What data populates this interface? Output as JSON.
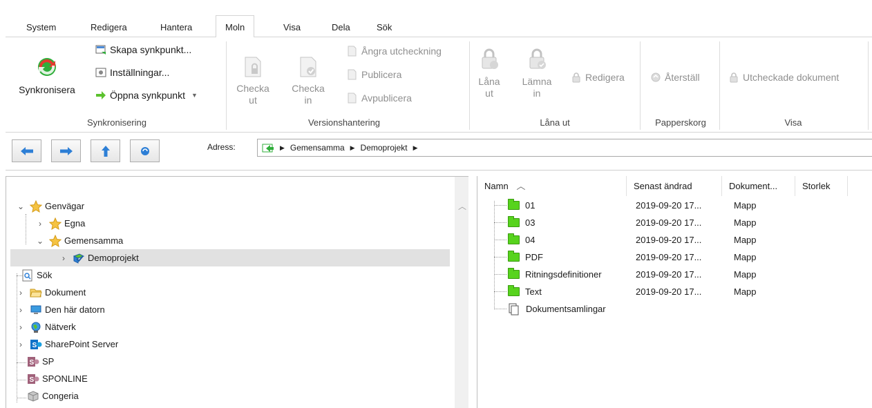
{
  "tabs": [
    {
      "label": "System",
      "active": false
    },
    {
      "label": "Redigera",
      "active": false
    },
    {
      "label": "Hantera",
      "active": false
    },
    {
      "label": "Moln",
      "active": true
    },
    {
      "label": "Visa",
      "active": false
    },
    {
      "label": "Dela",
      "active": false
    },
    {
      "label": "Sök",
      "active": false
    }
  ],
  "ribbon": {
    "sync": {
      "big_label": "Synkronisera",
      "create": "Skapa synkpunkt...",
      "settings": "Inställningar...",
      "open": "Öppna synkpunkt",
      "group": "Synkronisering"
    },
    "version": {
      "checkout_1": "Checka",
      "checkout_2": "ut",
      "checkin_1": "Checka",
      "checkin_2": "in",
      "undo": "Ångra utcheckning",
      "publish": "Publicera",
      "unpublish": "Avpublicera",
      "group": "Versionshantering"
    },
    "loan": {
      "borrow_1": "Låna",
      "borrow_2": "ut",
      "return_1": "Lämna",
      "return_2": "in",
      "edit": "Redigera",
      "group": "Låna ut"
    },
    "trash": {
      "restore": "Återställ",
      "group": "Papperskorg"
    },
    "view": {
      "checked_out": "Utcheckade dokument",
      "group": "Visa"
    }
  },
  "address": {
    "label": "Adress:",
    "crumbs": [
      "Gemensamma",
      "Demoprojekt"
    ]
  },
  "tree": [
    {
      "label": "Genvägar",
      "expanded": true
    },
    {
      "label": "Egna"
    },
    {
      "label": "Gemensamma",
      "expanded": true
    },
    {
      "label": "Demoprojekt",
      "selected": true
    },
    {
      "label": "Sök"
    },
    {
      "label": "Dokument"
    },
    {
      "label": "Den här datorn"
    },
    {
      "label": "Nätverk"
    },
    {
      "label": "SharePoint Server"
    },
    {
      "label": "SP"
    },
    {
      "label": "SPONLINE"
    },
    {
      "label": "Congeria"
    }
  ],
  "list": {
    "columns": [
      "Namn",
      "Senast ändrad",
      "Dokument...",
      "Storlek"
    ],
    "rows": [
      {
        "name": "01",
        "date": "2019-09-20 17...",
        "type": "Mapp",
        "icon": "folder-icon"
      },
      {
        "name": "03",
        "date": "2019-09-20 17...",
        "type": "Mapp",
        "icon": "folder-icon"
      },
      {
        "name": "04",
        "date": "2019-09-20 17...",
        "type": "Mapp",
        "icon": "folder-icon"
      },
      {
        "name": "PDF",
        "date": "2019-09-20 17...",
        "type": "Mapp",
        "icon": "folder-icon"
      },
      {
        "name": "Ritningsdefinitioner",
        "date": "2019-09-20 17...",
        "type": "Mapp",
        "icon": "folder-icon"
      },
      {
        "name": "Text",
        "date": "2019-09-20 17...",
        "type": "Mapp",
        "icon": "folder-icon"
      },
      {
        "name": "Dokumentsamlingar",
        "date": "",
        "type": "",
        "icon": "document-collection-icon"
      }
    ]
  },
  "colors": {
    "folder": "#57d31d",
    "selection": "#e1e1e1",
    "nav_arrow": "#2d7fd6"
  }
}
